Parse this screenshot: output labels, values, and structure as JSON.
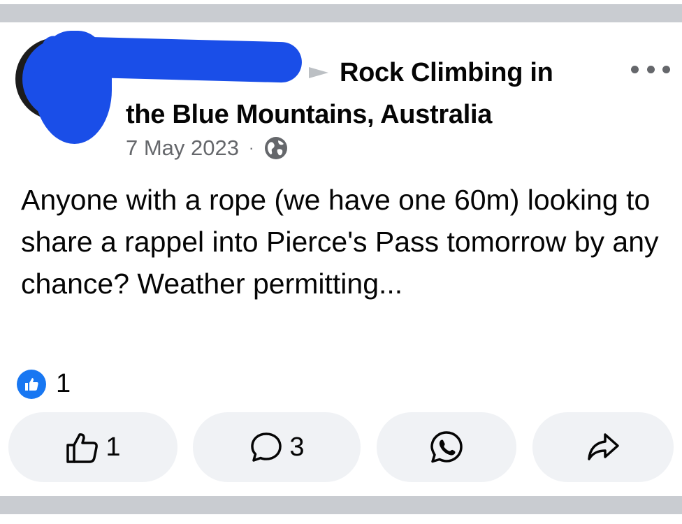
{
  "post": {
    "group_title_line1": "Rock Climbing in",
    "group_title_line2": "the Blue Mountains, Australia",
    "date": "7 May 2023",
    "separator": "·",
    "audience_icon": "globe-icon",
    "body": "Anyone with a rope (we have one 60m) looking to share a rappel into Pierce's Pass tomorrow by any chance? Weather permitting...",
    "reaction_count": "1"
  },
  "actions": {
    "like_count": "1",
    "comment_count": "3",
    "whatsapp_icon": "whatsapp-icon",
    "share_icon": "share-icon"
  },
  "colors": {
    "redaction": "#1a4ee8",
    "facebook_blue": "#1877f2",
    "secondary_text": "#65676b",
    "button_bg": "#f0f2f5",
    "separator": "#c9ccd1"
  }
}
